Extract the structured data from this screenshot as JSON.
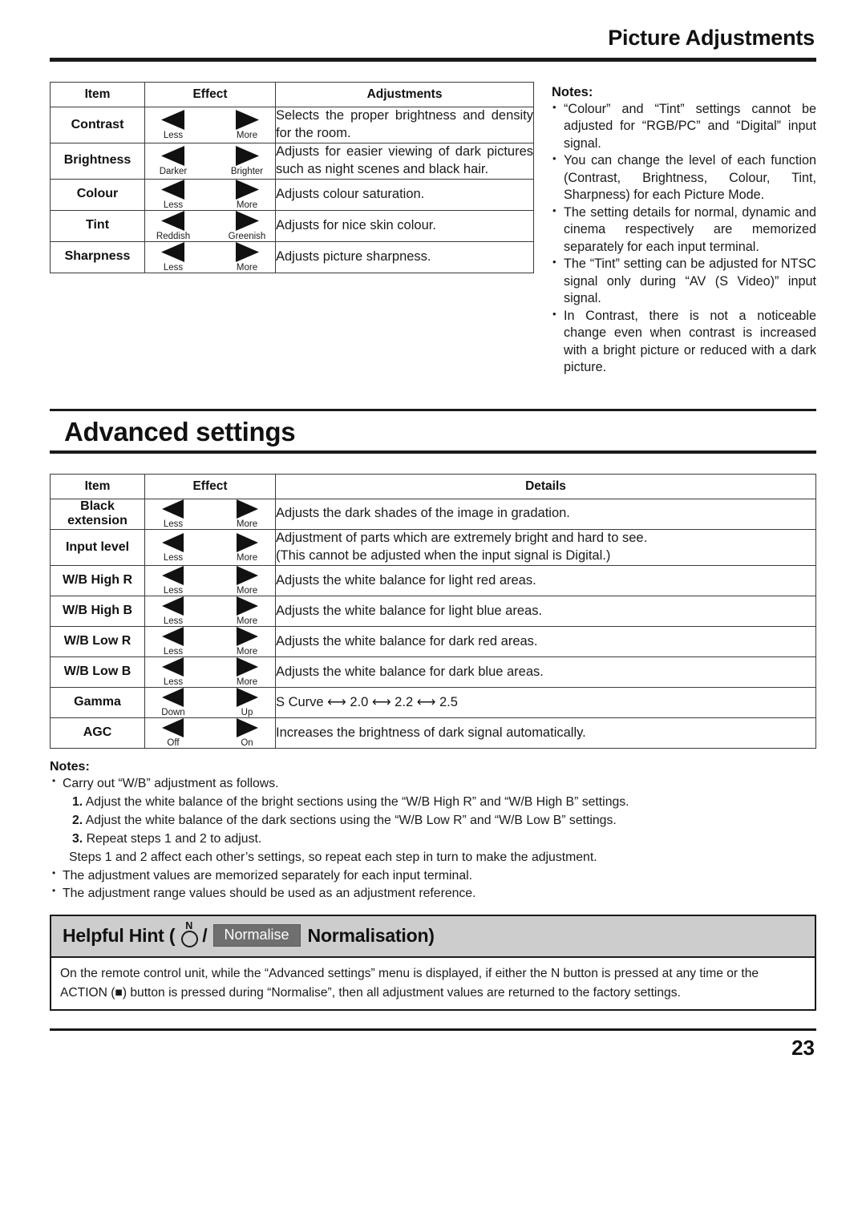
{
  "header": {
    "title": "Picture Adjustments"
  },
  "picture_table": {
    "columns": [
      "Item",
      "Effect",
      "Adjustments"
    ],
    "rows": [
      {
        "item": "Contrast",
        "left_label": "Less",
        "right_label": "More",
        "description": "Selects the proper brightness and density for the room."
      },
      {
        "item": "Brightness",
        "left_label": "Darker",
        "right_label": "Brighter",
        "description": "Adjusts for easier viewing of dark pictures such as night scenes and black hair."
      },
      {
        "item": "Colour",
        "left_label": "Less",
        "right_label": "More",
        "description": "Adjusts colour saturation."
      },
      {
        "item": "Tint",
        "left_label": "Reddish",
        "right_label": "Greenish",
        "description": "Adjusts for nice skin colour."
      },
      {
        "item": "Sharpness",
        "left_label": "Less",
        "right_label": "More",
        "description": "Adjusts picture sharpness."
      }
    ]
  },
  "picture_notes": {
    "title": "Notes:",
    "items": [
      "“Colour” and “Tint” settings cannot be adjusted for “RGB/PC” and “Digital” input signal.",
      "You can change the level of each function (Contrast, Brightness, Colour, Tint, Sharpness) for each Picture Mode.",
      "The setting details for normal, dynamic and cinema respectively are memorized separately for each input terminal.",
      "The “Tint” setting can be adjusted for NTSC signal only during “AV (S Video)” input signal.",
      "In Contrast, there is not a noticeable change even when contrast is increased with a bright picture or reduced with a dark picture."
    ]
  },
  "advanced": {
    "heading": "Advanced settings",
    "columns": [
      "Item",
      "Effect",
      "Details"
    ],
    "rows": [
      {
        "item": "Black extension",
        "left_label": "Less",
        "right_label": "More",
        "details": [
          "Adjusts the dark shades of the image in gradation."
        ]
      },
      {
        "item": "Input level",
        "left_label": "Less",
        "right_label": "More",
        "details": [
          "Adjustment of parts which are extremely bright and hard to see.",
          "(This cannot be adjusted when the input signal is Digital.)"
        ]
      },
      {
        "item": "W/B High R",
        "left_label": "Less",
        "right_label": "More",
        "details": [
          "Adjusts the white balance for light red areas."
        ]
      },
      {
        "item": "W/B High B",
        "left_label": "Less",
        "right_label": "More",
        "details": [
          "Adjusts the white balance for light blue areas."
        ]
      },
      {
        "item": "W/B Low R",
        "left_label": "Less",
        "right_label": "More",
        "details": [
          "Adjusts the white balance for dark red areas."
        ]
      },
      {
        "item": "W/B Low B",
        "left_label": "Less",
        "right_label": "More",
        "details": [
          "Adjusts the white balance for dark blue areas."
        ]
      },
      {
        "item": "Gamma",
        "left_label": "Down",
        "right_label": "Up",
        "details": [
          "S Curve ⟷ 2.0 ⟷ 2.2 ⟷ 2.5"
        ]
      },
      {
        "item": "AGC",
        "left_label": "Off",
        "right_label": "On",
        "details": [
          "Increases the brightness of dark signal automatically."
        ]
      }
    ]
  },
  "advanced_notes": {
    "title": "Notes:",
    "first_bullet": "Carry out “W/B” adjustment as follows.",
    "steps": [
      {
        "num": "1.",
        "text": "Adjust the white balance of the bright sections using the “W/B High R” and “W/B High B” settings."
      },
      {
        "num": "2.",
        "text": "Adjust the white balance of the dark sections using the “W/B Low R” and “W/B Low B” settings."
      },
      {
        "num": "3.",
        "text": "Repeat steps 1 and 2 to adjust."
      }
    ],
    "steps_note": "Steps 1 and 2 affect each other’s settings, so repeat each step in turn to make the adjustment.",
    "tail_bullets": [
      "The adjustment values are memorized separately for each input terminal.",
      "The adjustment range values should be used as an adjustment reference."
    ]
  },
  "hint": {
    "prefix": "Helpful Hint (",
    "n_label": "N",
    "slash": "/",
    "chip": "Normalise",
    "suffix": "Normalisation)",
    "body": "On the remote control unit, while the “Advanced settings” menu is displayed, if either the N button is pressed at any time or the ACTION (■) button is pressed during “Normalise”, then all adjustment values are returned to the factory settings."
  },
  "footer": {
    "page_number": "23"
  },
  "colors": {
    "ink": "#1a1a1a",
    "hint_header_bg": "#cdcdcd",
    "chip_bg": "#6f6f6f",
    "chip_text": "#ffffff"
  }
}
